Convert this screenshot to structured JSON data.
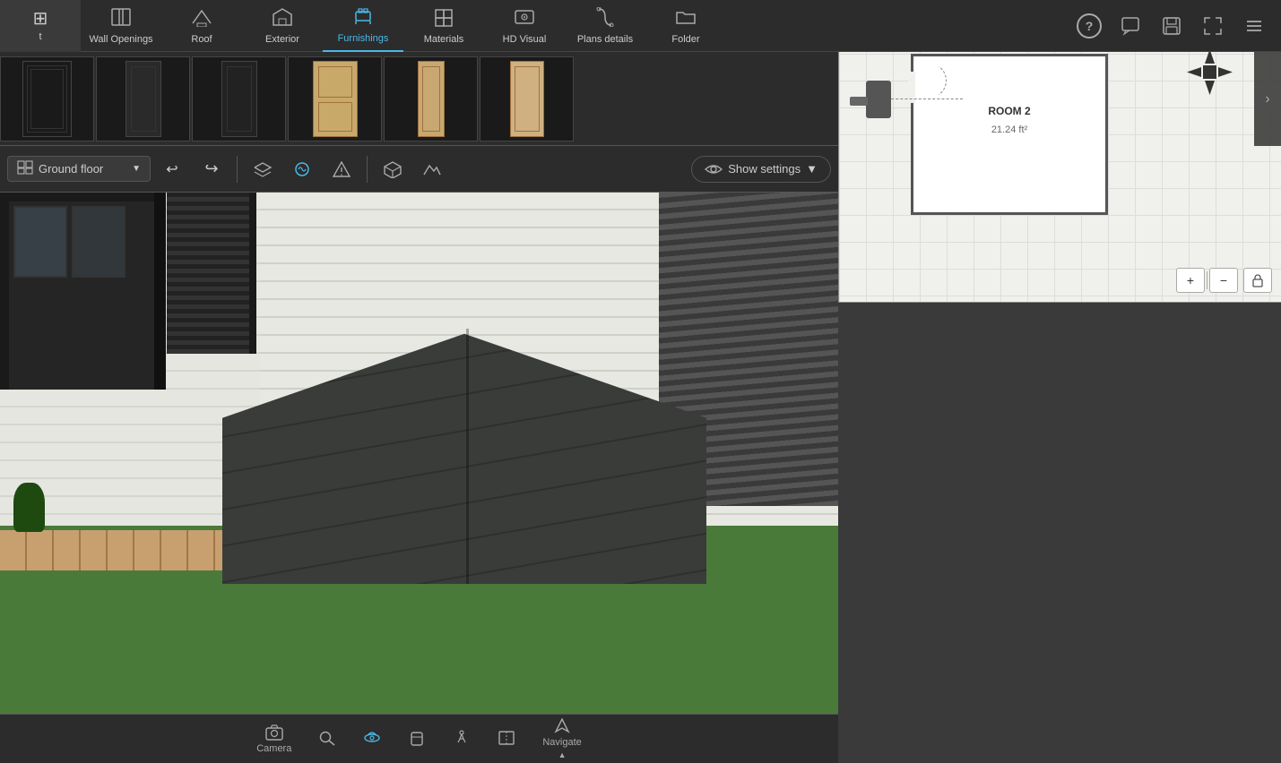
{
  "toolbar": {
    "items": [
      {
        "id": "wall-openings",
        "label": "Wall Openings",
        "icon": "⊞",
        "active": false
      },
      {
        "id": "roof",
        "label": "Roof",
        "icon": "⌂",
        "active": false
      },
      {
        "id": "exterior",
        "label": "Exterior",
        "icon": "⬡",
        "active": false
      },
      {
        "id": "furnishings",
        "label": "Furnishings",
        "icon": "⊡",
        "active": true
      },
      {
        "id": "materials",
        "label": "Materials",
        "icon": "◧",
        "active": false
      },
      {
        "id": "hd-visual",
        "label": "HD Visual",
        "icon": "📷",
        "active": false
      },
      {
        "id": "plans-details",
        "label": "Plans details",
        "icon": "♡",
        "active": false
      },
      {
        "id": "folder",
        "label": "Folder",
        "icon": "📁",
        "active": false
      }
    ]
  },
  "right_toolbar": {
    "help_label": "?",
    "chat_label": "💬",
    "save_label": "💾",
    "fullscreen_label": "⛶",
    "menu_label": "☰"
  },
  "floor_selector": {
    "label": "Ground floor",
    "icon": "▦"
  },
  "show_settings": {
    "label": "Show settings",
    "eye_icon": "👁"
  },
  "tools": {
    "undo_label": "↩",
    "redo_label": "↪",
    "tool1_label": "⊞",
    "tool2_label": "✦",
    "tool3_label": "⚠",
    "tool4_label": "❖",
    "tool5_label": "⛰"
  },
  "thumbnails": [
    {
      "id": "thumb1",
      "type": "dark",
      "selected": false
    },
    {
      "id": "thumb2",
      "type": "dark",
      "selected": false
    },
    {
      "id": "thumb3",
      "type": "dark",
      "selected": false
    },
    {
      "id": "thumb4",
      "type": "light",
      "selected": false
    },
    {
      "id": "thumb5",
      "type": "light-narrow",
      "selected": false
    },
    {
      "id": "thumb6",
      "type": "light-narrow2",
      "selected": false
    }
  ],
  "minimap": {
    "room2_label": "ROOM 2",
    "room2_area": "21.24 ft²",
    "zoom_in_label": "+",
    "zoom_out_label": "−",
    "lock_label": "🔒"
  },
  "bottom_nav": {
    "items": [
      {
        "id": "camera",
        "label": "Camera",
        "icon": "📷"
      },
      {
        "id": "zoom",
        "label": "Zoom",
        "icon": "🔍"
      },
      {
        "id": "orbit",
        "label": "Orbit",
        "icon": "⟳"
      },
      {
        "id": "pan",
        "label": "Pan",
        "icon": "✥"
      },
      {
        "id": "walk",
        "label": "Walk",
        "icon": "🚶"
      },
      {
        "id": "section",
        "label": "Section",
        "icon": "⊡"
      },
      {
        "id": "navigate",
        "label": "Navigate",
        "icon": "▶"
      }
    ]
  }
}
